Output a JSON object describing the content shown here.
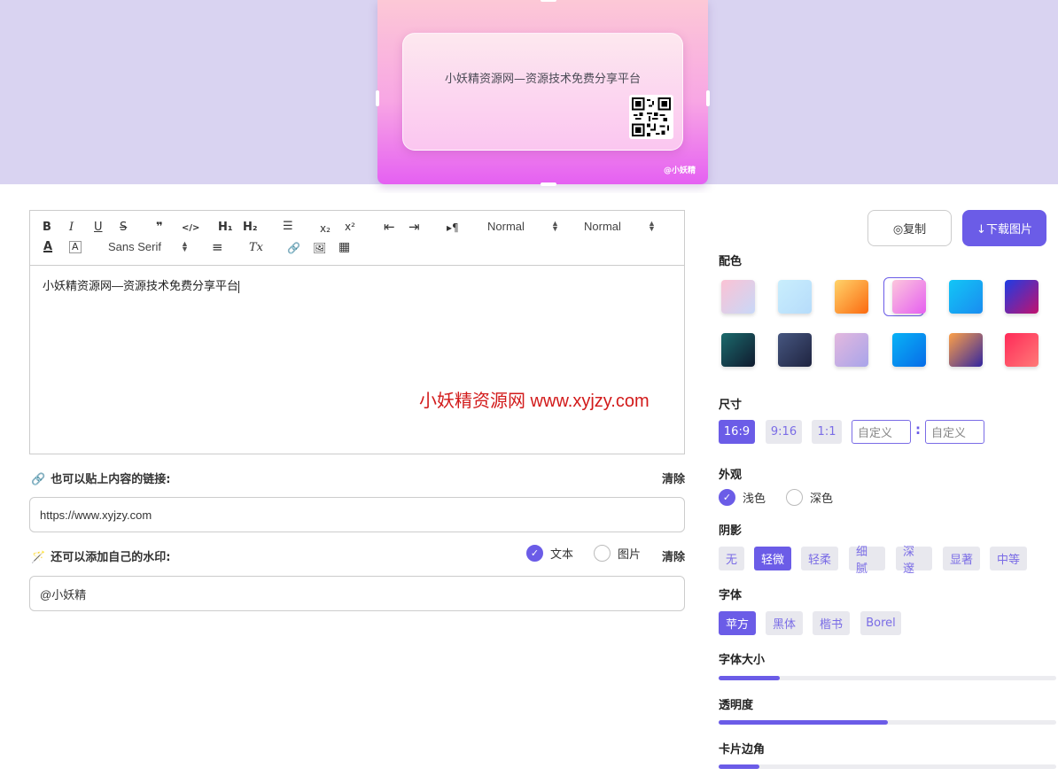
{
  "preview": {
    "card_text": "小妖精资源网—资源技术免费分享平台",
    "watermark": "@小妖精"
  },
  "toolbar": {
    "bold": "B",
    "italic": "I",
    "underline": "U",
    "strike": "S",
    "quote": "❞",
    "code": "</>",
    "h1": "H₁",
    "h2": "H₂",
    "list": "☰",
    "subscript": "x₂",
    "superscript": "x²",
    "outdent": "⇤",
    "indent": "⇥",
    "rtl": "▸¶",
    "select_size": "Normal",
    "select_header": "Normal",
    "font_color": "A",
    "bg_color": "A",
    "font_family": "Sans Serif",
    "align": "≡",
    "clean": "Tx",
    "link": "🔗",
    "image": "🖼",
    "video": "▦"
  },
  "editor": {
    "content": "小妖精资源网—资源技术免费分享平台",
    "overlay_watermark": "小妖精资源网 www.xyjzy.com"
  },
  "link_row": {
    "label": "也可以贴上内容的链接:",
    "clear": "清除",
    "value": "https://www.xyjzy.com"
  },
  "watermark_row": {
    "label": "还可以添加自己的水印:",
    "option_text": "文本",
    "option_image": "图片",
    "clear": "清除",
    "value": "@小妖精"
  },
  "actions": {
    "copy": "◎复制",
    "download": "↓下载图片"
  },
  "colors_section": {
    "title": "配色",
    "selected_index": 3,
    "swatches": [
      "#f8c8d8",
      "#c6eafc",
      "#fda63a",
      "#f5a0ef",
      "#1aa6f4",
      "#4b1fd6",
      "#11414a",
      "#2f3858",
      "#c6b4ea",
      "#0a90f0",
      "#e0607e",
      "#ff4c68"
    ]
  },
  "size_section": {
    "title": "尺寸",
    "options": [
      "16:9",
      "9:16",
      "1:1"
    ],
    "selected": "16:9",
    "custom_w_placeholder": "自定义",
    "custom_h_placeholder": "自定义",
    "separator": ":"
  },
  "appearance_section": {
    "title": "外观",
    "light": "浅色",
    "dark": "深色",
    "selected": "浅色"
  },
  "shadow_section": {
    "title": "阴影",
    "options": [
      "无",
      "轻微",
      "轻柔",
      "细腻",
      "深邃",
      "显著",
      "中等"
    ],
    "selected": "轻微"
  },
  "font_section": {
    "title": "字体",
    "options": [
      "苹方",
      "黑体",
      "楷书",
      "Borel"
    ],
    "selected": "苹方"
  },
  "sliders": {
    "font_size": {
      "title": "字体大小",
      "value": 0.18
    },
    "opacity": {
      "title": "透明度",
      "value": 0.5
    },
    "corner": {
      "title": "卡片边角",
      "value": 0.12
    }
  },
  "accent_color": "#6b5ce7"
}
